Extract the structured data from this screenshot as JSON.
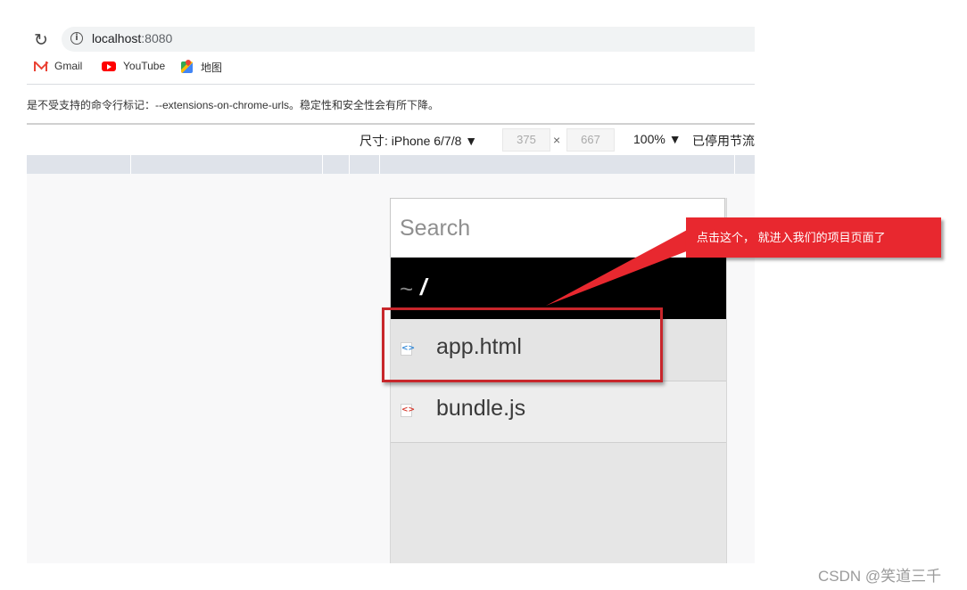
{
  "browser": {
    "url_host": "localhost",
    "url_port": ":8080",
    "bookmarks": [
      {
        "label": "Gmail",
        "icon": "gmail-icon"
      },
      {
        "label": "YouTube",
        "icon": "youtube-icon"
      },
      {
        "label": "地图",
        "icon": "maps-icon"
      }
    ],
    "warning": "是不受支持的命令行标记：--extensions-on-chrome-urls。稳定性和安全性会有所下降。"
  },
  "device_toolbar": {
    "dimensions_label": "尺寸: iPhone 6/7/8 ▼",
    "width": "375",
    "times": "×",
    "height": "667",
    "zoom": "100% ▼",
    "throttle": "已停用节流"
  },
  "file_browser": {
    "search_placeholder": "Search",
    "path_tilde": "~",
    "path_slash": "/",
    "files": [
      {
        "name": "app.html",
        "type": "html"
      },
      {
        "name": "bundle.js",
        "type": "js"
      }
    ]
  },
  "annotation": {
    "callout": "点击这个，  就进入我们的项目页面了",
    "callout_color": "#e8282f",
    "highlight_color": "#c8262b"
  },
  "watermark": "CSDN @笑道三千"
}
